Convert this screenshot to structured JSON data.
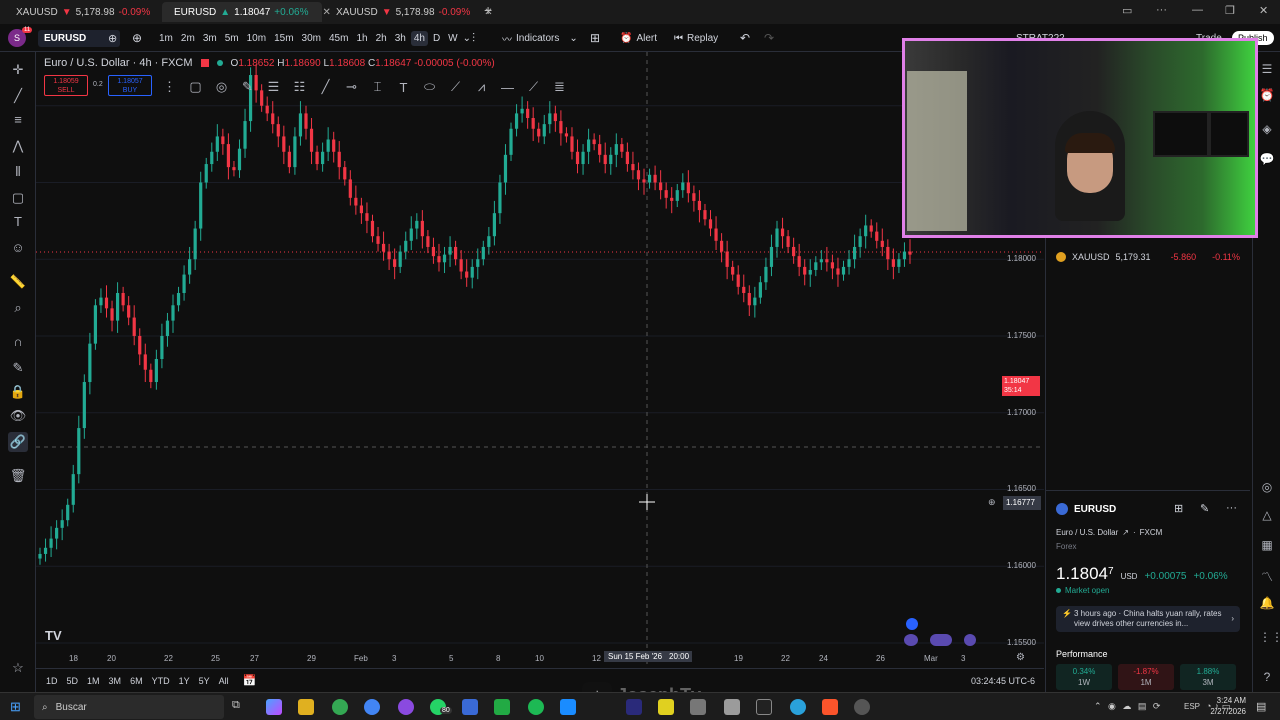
{
  "browser_tabs": [
    {
      "symbol": "XAUUSD",
      "arrow": "▼",
      "price": "5,178.98",
      "change": "-0.09%",
      "dir": "down"
    },
    {
      "symbol": "EURUSD",
      "arrow": "▲",
      "price": "1.18047",
      "change": "+0.06%",
      "dir": "up"
    },
    {
      "symbol": "XAUUSD",
      "arrow": "▼",
      "price": "5,178.98",
      "change": "-0.09%",
      "dir": "down"
    }
  ],
  "toolbar": {
    "symbol": "EURUSD",
    "timeframes": [
      "1m",
      "2m",
      "3m",
      "5m",
      "10m",
      "15m",
      "30m",
      "45m",
      "1h",
      "2h",
      "3h",
      "4h",
      "D",
      "W"
    ],
    "active_timeframe": "4h",
    "indicators_label": "Indicators",
    "alert_label": "Alert",
    "replay_label": "Replay",
    "strategy_label": "STRAT222",
    "trade_label": "Trade",
    "publish_label": "Publish",
    "avatar_letter": "S",
    "notif_count": "11"
  },
  "legend": {
    "title": "Euro / U.S. Dollar · 4h · FXCM",
    "o_label": "O",
    "o": "1.18652",
    "h_label": "H",
    "h": "1.18690",
    "l_label": "L",
    "l": "1.18608",
    "c_label": "C",
    "c": "1.18647",
    "change": "-0.00005 (-0.00%)",
    "sell_price": "1.18059",
    "sell_label": "SELL",
    "spread": "0.2",
    "buy_price": "1.18057",
    "buy_label": "BUY"
  },
  "chart_data": {
    "type": "candlestick",
    "y_ticks": [
      "1.19000",
      "1.18500",
      "1.18000",
      "1.17500",
      "1.17000",
      "1.16500",
      "1.16000",
      "1.15500"
    ],
    "ylim": [
      1.1535,
      1.1935
    ],
    "x_ticks": [
      "18",
      "20",
      "22",
      "25",
      "27",
      "29",
      "Feb",
      "3",
      "5",
      "8",
      "10",
      "12",
      "Sun 15 Feb '26",
      "20:00",
      "19",
      "22",
      "24",
      "26",
      "Mar",
      "3"
    ],
    "closes": [
      1.1608,
      1.1612,
      1.1618,
      1.1625,
      1.163,
      1.164,
      1.166,
      1.169,
      1.172,
      1.1745,
      1.177,
      1.1775,
      1.1768,
      1.176,
      1.1778,
      1.177,
      1.1762,
      1.175,
      1.1738,
      1.1728,
      1.172,
      1.1735,
      1.175,
      1.176,
      1.177,
      1.1778,
      1.179,
      1.18,
      1.182,
      1.185,
      1.1862,
      1.187,
      1.188,
      1.1875,
      1.186,
      1.1858,
      1.1872,
      1.189,
      1.192,
      1.191,
      1.19,
      1.1895,
      1.1888,
      1.188,
      1.187,
      1.186,
      1.188,
      1.1895,
      1.1885,
      1.187,
      1.1862,
      1.187,
      1.1878,
      1.187,
      1.186,
      1.1852,
      1.184,
      1.1835,
      1.183,
      1.1825,
      1.1815,
      1.181,
      1.1805,
      1.18,
      1.1795,
      1.1805,
      1.1812,
      1.182,
      1.1825,
      1.1815,
      1.1808,
      1.1802,
      1.1798,
      1.1803,
      1.1808,
      1.18,
      1.1792,
      1.1788,
      1.1795,
      1.18,
      1.1808,
      1.1815,
      1.183,
      1.185,
      1.1868,
      1.1885,
      1.1895,
      1.1898,
      1.1892,
      1.1885,
      1.188,
      1.1888,
      1.1895,
      1.189,
      1.1882,
      1.188,
      1.187,
      1.1862,
      1.187,
      1.1878,
      1.1875,
      1.1868,
      1.1862,
      1.1868,
      1.1875,
      1.187,
      1.1862,
      1.1858,
      1.1852,
      1.185,
      1.1855,
      1.185,
      1.1845,
      1.184,
      1.1838,
      1.1845,
      1.185,
      1.1843,
      1.1838,
      1.1832,
      1.1826,
      1.182,
      1.1812,
      1.1805,
      1.1795,
      1.179,
      1.1782,
      1.1778,
      1.177,
      1.1775,
      1.1785,
      1.1795,
      1.1808,
      1.182,
      1.1815,
      1.1808,
      1.1802,
      1.1795,
      1.179,
      1.1793,
      1.1798,
      1.18,
      1.1798,
      1.1794,
      1.179,
      1.1795,
      1.18,
      1.1808,
      1.1815,
      1.1822,
      1.1818,
      1.1812,
      1.1808,
      1.18,
      1.1795,
      1.18,
      1.1805,
      1.1803
    ],
    "current_price": "1.18047",
    "countdown": "35:14",
    "crosshair_price": "1.16777",
    "crosshair_date": "Sun 15 Feb '26"
  },
  "bottombar": {
    "ranges": [
      "1D",
      "5D",
      "1M",
      "3M",
      "6M",
      "YTD",
      "1Y",
      "5Y",
      "All"
    ],
    "clock": "03:24:45 UTC-6"
  },
  "watchlist": {
    "row_symbol": "XAUUSD",
    "row_price": "5,179.31",
    "row_change": "-5.860",
    "row_pct": "-0.11%"
  },
  "details": {
    "symbol": "EURUSD",
    "name": "Euro / U.S. Dollar",
    "exchange": "FXCM",
    "category": "Forex",
    "price_main": "1.1804",
    "price_small": "7",
    "currency": "USD",
    "change": "+0.00075",
    "change_pct": "+0.06%",
    "market_status": "Market open",
    "news_time": "3 hours ago",
    "news_text": "China halts yuan rally, rates view drives other currencies in...",
    "performance_label": "Performance",
    "perf": [
      {
        "value": "0.34%",
        "period": "1W",
        "dir": "up"
      },
      {
        "value": "-1.87%",
        "period": "1M",
        "dir": "down"
      },
      {
        "value": "1.88%",
        "period": "3M",
        "dir": "up"
      }
    ]
  },
  "taskbar": {
    "search_placeholder": "Buscar",
    "lang": "ESP",
    "time": "3:24 AM",
    "date": "2/27/2026",
    "whatsapp_badge": "80"
  },
  "watermark": "JosephTv",
  "colors": {
    "up": "#22ab94",
    "down": "#f23645",
    "accent": "#2962ff"
  }
}
